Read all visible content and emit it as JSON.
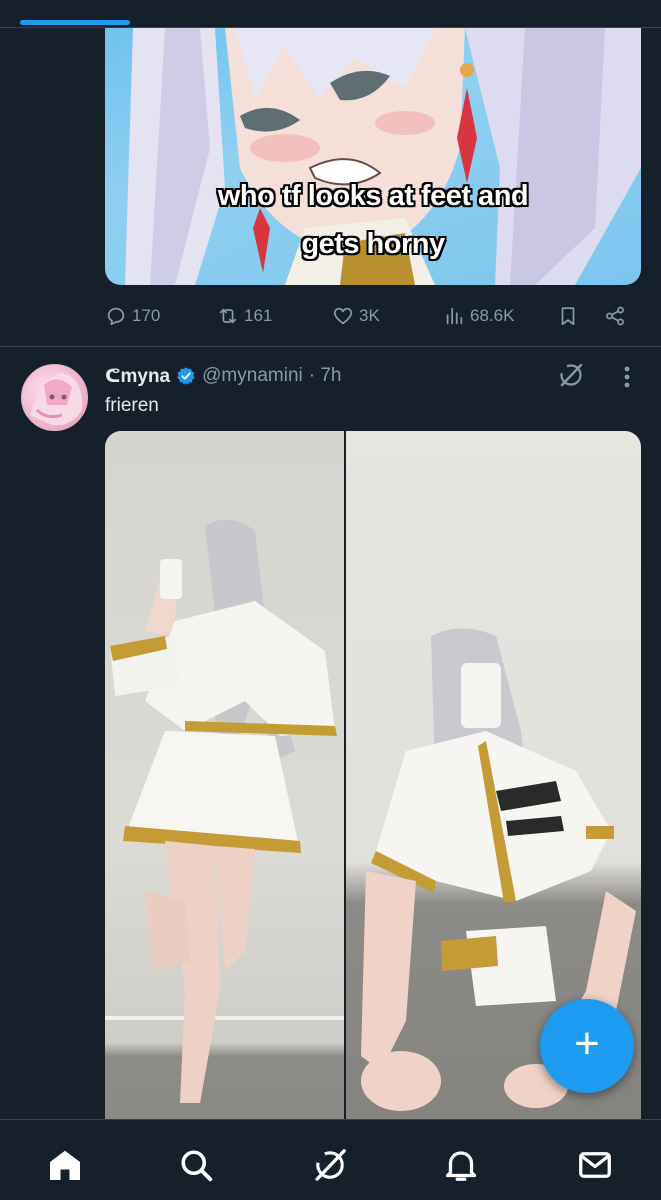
{
  "feed": {
    "post1": {
      "image_caption_line1": "who tf looks at feet and",
      "image_caption_line2": "gets horny",
      "replies": "170",
      "reposts": "161",
      "likes": "3K",
      "views": "68.6K"
    },
    "post2": {
      "display_name": "ᕦmyna",
      "handle": "@mynamini",
      "time": "· 7h",
      "text": "frieren"
    }
  },
  "colors": {
    "background": "#15202b",
    "accent": "#1d9bf0",
    "muted_text": "#8b98a5",
    "divider": "#38444d"
  },
  "icons": {
    "reply": "reply-icon",
    "repost": "repost-icon",
    "like": "heart-icon",
    "views": "views-icon",
    "bookmark": "bookmark-icon",
    "share": "share-icon",
    "grok": "grok-icon",
    "more": "more-icon",
    "compose": "plus-icon",
    "nav": [
      "home-icon",
      "search-icon",
      "grok-icon",
      "bell-icon",
      "mail-icon"
    ]
  }
}
